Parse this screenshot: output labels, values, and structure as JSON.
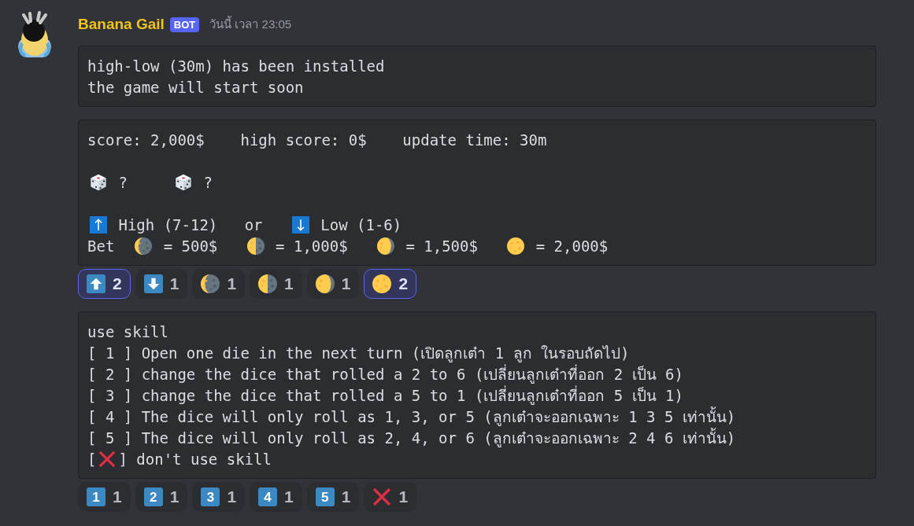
{
  "message": {
    "author": "Banana Gail",
    "badge": "BOT",
    "timestamp": "วันนี้ เวลา 23:05",
    "blocks": [
      {
        "paragraphs": [
          [
            [
              {
                "kind": "text",
                "text": "high-low (30m) has been installed"
              }
            ],
            [
              {
                "kind": "text",
                "text": "the game will start soon"
              }
            ]
          ]
        ]
      },
      {
        "paragraphs": [
          [
            [
              {
                "kind": "text",
                "text": "score: 2,000$    high score: 0$    update time: 30m"
              }
            ]
          ],
          [
            [
              {
                "kind": "die"
              },
              {
                "kind": "text",
                "text": " ?     "
              },
              {
                "kind": "die"
              },
              {
                "kind": "text",
                "text": " ?"
              }
            ]
          ],
          [
            [
              {
                "kind": "up-key"
              },
              {
                "kind": "text",
                "text": " High (7-12)"
              },
              {
                "kind": "text",
                "text": "   or   "
              },
              {
                "kind": "down-key"
              },
              {
                "kind": "text",
                "text": " Low (1-6)"
              }
            ],
            [
              {
                "kind": "text",
                "text": "Bet  "
              },
              {
                "kind": "moon-crescent"
              },
              {
                "kind": "text",
                "text": " = 500$   "
              },
              {
                "kind": "moon-half"
              },
              {
                "kind": "text",
                "text": " = 1,000$   "
              },
              {
                "kind": "moon-gibbous"
              },
              {
                "kind": "text",
                "text": " = 1,500$   "
              },
              {
                "kind": "moon-full"
              },
              {
                "kind": "text",
                "text": " = 2,000$"
              }
            ]
          ]
        ],
        "reactions": [
          {
            "kind": "up-key",
            "count": "2",
            "selected": true
          },
          {
            "kind": "down-key",
            "count": "1",
            "selected": false
          },
          {
            "kind": "moon-crescent",
            "count": "1",
            "selected": false
          },
          {
            "kind": "moon-half",
            "count": "1",
            "selected": false
          },
          {
            "kind": "moon-gibbous",
            "count": "1",
            "selected": false
          },
          {
            "kind": "moon-full",
            "count": "2",
            "selected": true
          }
        ]
      },
      {
        "paragraphs": [
          [
            [
              {
                "kind": "text",
                "text": "use skill"
              }
            ],
            [
              {
                "kind": "text",
                "text": "[ 1 ] Open one die in the next turn (เปิดลูกเต๋า 1 ลูก ในรอบถัดไป)"
              }
            ],
            [
              {
                "kind": "text",
                "text": "[ 2 ] change the dice that rolled a 2 to 6 (เปลี่ยนลูกเต๋าที่ออก 2 เป็น 6)"
              }
            ],
            [
              {
                "kind": "text",
                "text": "[ 3 ] change the dice that rolled a 5 to 1 (เปลี่ยนลูกเต๋าที่ออก 5 เป็น 1)"
              }
            ],
            [
              {
                "kind": "text",
                "text": "[ 4 ] The dice will only roll as 1, 3, or 5 (ลูกเต๋าจะออกเฉพาะ 1 3 5 เท่านั้น)"
              }
            ],
            [
              {
                "kind": "text",
                "text": "[ 5 ] The dice will only roll as 2, 4, or 6 (ลูกเต๋าจะออกเฉพาะ 2 4 6 เท่านั้น)"
              }
            ],
            [
              {
                "kind": "text",
                "text": "["
              },
              {
                "kind": "cross"
              },
              {
                "kind": "text",
                "text": "] don't use skill"
              }
            ]
          ]
        ],
        "reactions": [
          {
            "kind": "keycap",
            "key": "1",
            "count": "1",
            "selected": false
          },
          {
            "kind": "keycap",
            "key": "2",
            "count": "1",
            "selected": false
          },
          {
            "kind": "keycap",
            "key": "3",
            "count": "1",
            "selected": false
          },
          {
            "kind": "keycap",
            "key": "4",
            "count": "1",
            "selected": false
          },
          {
            "kind": "keycap",
            "key": "5",
            "count": "1",
            "selected": false
          },
          {
            "kind": "cross",
            "count": "1",
            "selected": false
          }
        ]
      }
    ]
  }
}
